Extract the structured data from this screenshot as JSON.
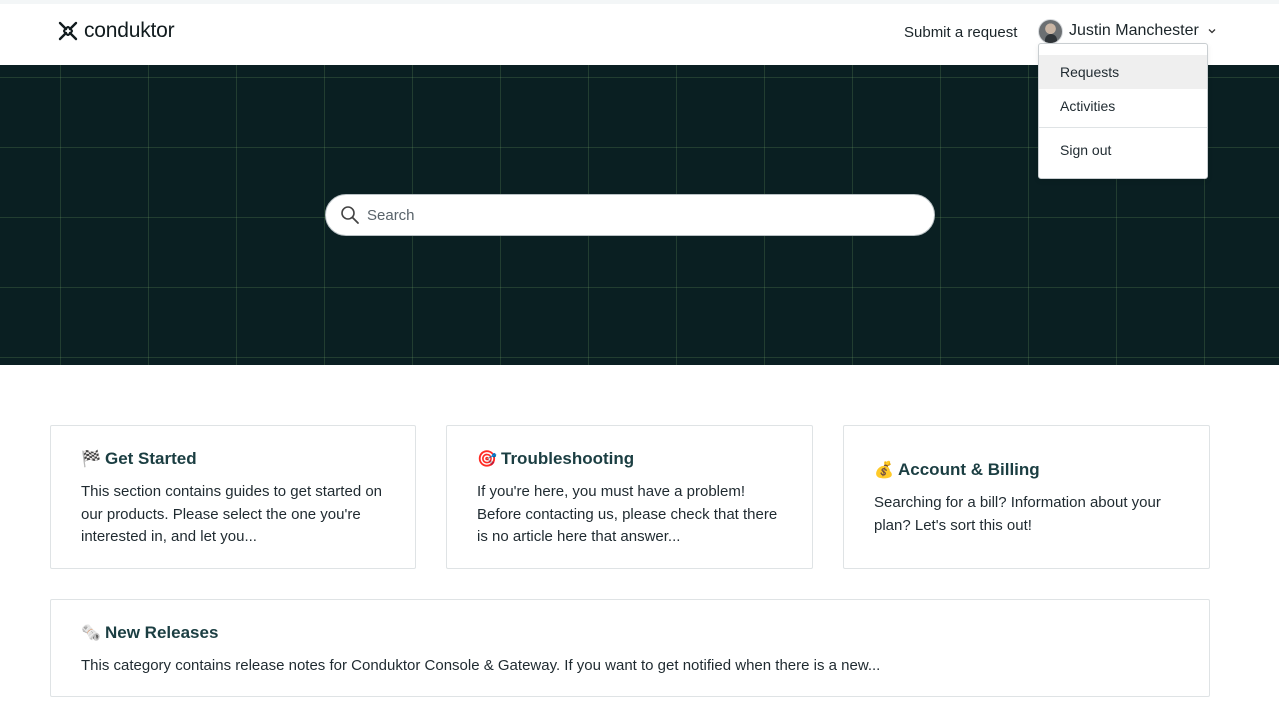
{
  "header": {
    "logo_text": "conduktor",
    "submit_request": "Submit a request",
    "user_name": "Justin Manchester"
  },
  "user_dropdown": {
    "items": [
      "Requests",
      "Activities"
    ],
    "sign_out": "Sign out"
  },
  "search": {
    "placeholder": "Search"
  },
  "categories": [
    {
      "emoji": "🏁",
      "title": "Get Started",
      "description": "This section contains guides to get started on our products. Please select the one you're interested in, and let you..."
    },
    {
      "emoji": "🎯",
      "title": "Troubleshooting",
      "description": "If you're here, you must have a problem! Before contacting us, please check that there is no article here that answer..."
    },
    {
      "emoji": "💰",
      "title": "Account & Billing",
      "description": "Searching for a bill? Information about your plan? Let's sort this out!"
    },
    {
      "emoji": "🗞️",
      "title": "New Releases",
      "description": "This category contains release notes for Conduktor Console & Gateway. If you want to get notified when there is a new..."
    }
  ],
  "colors": {
    "hero_bg": "#0a1f22",
    "card_title": "#1b3e42",
    "dropdown_active_bg": "#efefef"
  }
}
